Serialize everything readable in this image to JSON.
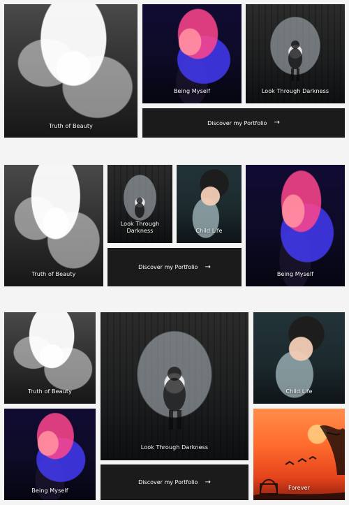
{
  "sections": [
    {
      "tiles": [
        {
          "id": "beauty",
          "caption": "Truth of Beauty"
        },
        {
          "id": "myself",
          "caption": "Being Myself"
        },
        {
          "id": "darkness",
          "caption": "Look Through Darkness"
        }
      ],
      "cta": {
        "label": "Discover my Portfolio",
        "arrow": "→"
      }
    },
    {
      "tiles": [
        {
          "id": "beauty",
          "caption": "Truth of Beauty"
        },
        {
          "id": "darkness",
          "caption_line1": "Look Through",
          "caption_line2": "Darkness"
        },
        {
          "id": "child",
          "caption": "Child Life"
        },
        {
          "id": "myself",
          "caption": "Being Myself"
        }
      ],
      "cta": {
        "label": "Discover my Portfolio",
        "arrow": "→"
      }
    },
    {
      "tiles": [
        {
          "id": "beauty",
          "caption": "Truth of Beauty"
        },
        {
          "id": "darkness",
          "caption": "Look Through Darkness"
        },
        {
          "id": "child",
          "caption": "Child Life"
        },
        {
          "id": "myself",
          "caption": "Being Myself"
        },
        {
          "id": "forever",
          "caption": "Forever"
        }
      ],
      "cta": {
        "label": "Discover my Portfolio",
        "arrow": "→"
      }
    }
  ],
  "colors": {
    "page_bg": "#f4f4f4",
    "cta_bg": "#1b1b1b",
    "text": "#ffffff"
  }
}
